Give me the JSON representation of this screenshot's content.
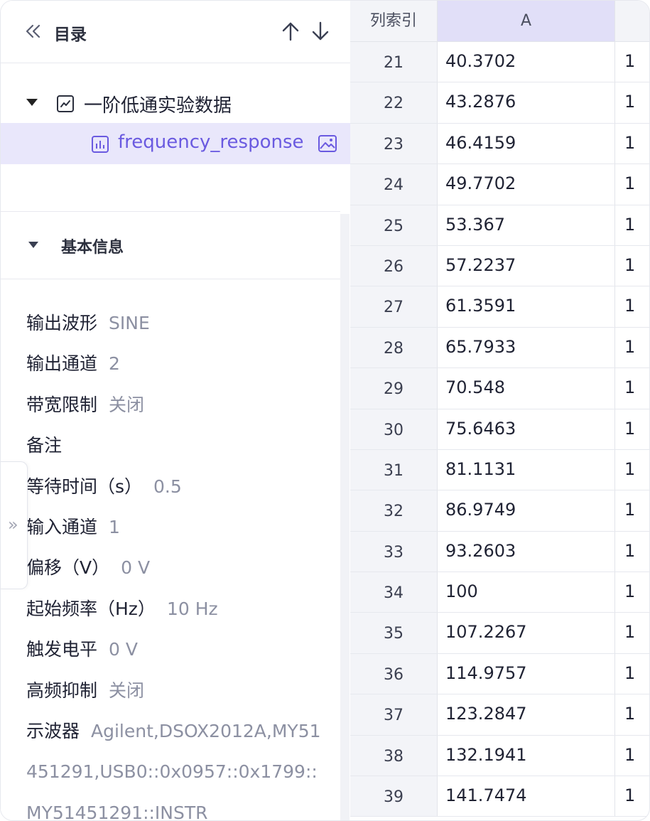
{
  "toc": {
    "title": "目录",
    "root_label": "一阶低通实验数据",
    "child_label": "frequency_response"
  },
  "info": {
    "section_title": "基本信息",
    "props": [
      {
        "key": "输出波形",
        "value": "SINE"
      },
      {
        "key": "输出通道",
        "value": "2"
      },
      {
        "key": "带宽限制",
        "value": "关闭"
      },
      {
        "key": "备注",
        "value": ""
      },
      {
        "key": "等待时间（s）",
        "value": "0.5"
      },
      {
        "key": "输入通道",
        "value": "1"
      },
      {
        "key": "偏移（V）",
        "value": "0 V"
      },
      {
        "key": "起始频率（Hz）",
        "value": "10 Hz"
      },
      {
        "key": "触发电平",
        "value": "0 V"
      },
      {
        "key": "高频抑制",
        "value": "关闭"
      },
      {
        "key": "示波器",
        "value": "Agilent,DSOX2012A,MY51451291,USB0::0x0957::0x1799::MY51451291::INSTR"
      }
    ],
    "expander_glyph": "»"
  },
  "table": {
    "headers": {
      "index": "列索引",
      "a": "A",
      "b": ""
    },
    "rows": [
      {
        "index": "21",
        "a": "40.3702",
        "b": "1"
      },
      {
        "index": "22",
        "a": "43.2876",
        "b": "1"
      },
      {
        "index": "23",
        "a": "46.4159",
        "b": "1"
      },
      {
        "index": "24",
        "a": "49.7702",
        "b": "1"
      },
      {
        "index": "25",
        "a": "53.367",
        "b": "1"
      },
      {
        "index": "26",
        "a": "57.2237",
        "b": "1"
      },
      {
        "index": "27",
        "a": "61.3591",
        "b": "1"
      },
      {
        "index": "28",
        "a": "65.7933",
        "b": "1"
      },
      {
        "index": "29",
        "a": "70.548",
        "b": "1"
      },
      {
        "index": "30",
        "a": "75.6463",
        "b": "1"
      },
      {
        "index": "31",
        "a": "81.1131",
        "b": "1"
      },
      {
        "index": "32",
        "a": "86.9749",
        "b": "1"
      },
      {
        "index": "33",
        "a": "93.2603",
        "b": "1"
      },
      {
        "index": "34",
        "a": "100",
        "b": "1"
      },
      {
        "index": "35",
        "a": "107.2267",
        "b": "1"
      },
      {
        "index": "36",
        "a": "114.9757",
        "b": "1"
      },
      {
        "index": "37",
        "a": "123.2847",
        "b": "1"
      },
      {
        "index": "38",
        "a": "132.1941",
        "b": "1"
      },
      {
        "index": "39",
        "a": "141.7474",
        "b": "1"
      }
    ]
  },
  "colors": {
    "accent": "#6a5ae0",
    "selected_bg": "#e9e7fb",
    "header_accent_bg": "#e1dff8"
  }
}
